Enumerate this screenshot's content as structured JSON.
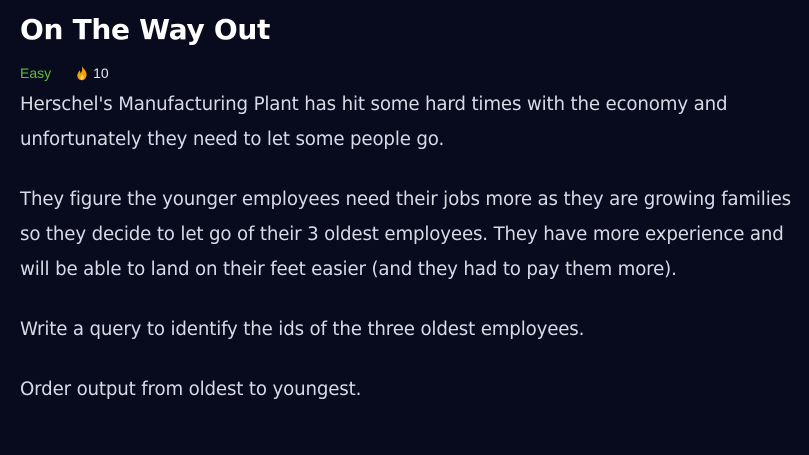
{
  "problem": {
    "title": "On The Way Out",
    "difficulty": "Easy",
    "likes": "10",
    "icon": "fire-icon",
    "difficulty_color": "#5bc236",
    "paragraphs": [
      "Herschel's Manufacturing Plant has hit some hard times with the economy and unfortunately they need to let some people go.",
      "They figure the younger employees need their jobs more as they are growing families so they decide to let go of their 3 oldest employees. They have more experience and will be able to land on their feet easier (and they had to pay them more).",
      "Write a query to identify the ids of the three oldest employees.",
      "Order output from oldest to youngest."
    ]
  }
}
